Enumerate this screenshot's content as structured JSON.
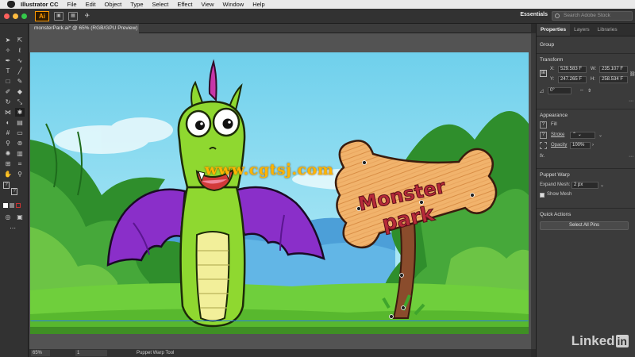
{
  "menubar": {
    "app": "Illustrator CC",
    "items": [
      "File",
      "Edit",
      "Object",
      "Type",
      "Select",
      "Effect",
      "View",
      "Window",
      "Help"
    ]
  },
  "appbar": {
    "logo": "Ai",
    "workspace": "Essentials",
    "stock_placeholder": "Search Adobe Stock"
  },
  "document": {
    "tab_title": "monsterPark.ai* @ 65% (RGB/GPU Preview)"
  },
  "status": {
    "zoom": "65%",
    "page": "1",
    "tool": "Puppet Warp Tool"
  },
  "panel": {
    "tabs": [
      "Properties",
      "Layers",
      "Libraries"
    ],
    "selection_type": "Group",
    "transform": {
      "title": "Transform",
      "x_label": "X:",
      "x": "529.583 F",
      "y_label": "Y:",
      "y": "247.265 F",
      "w_label": "W:",
      "w": "235.107 F",
      "h_label": "H:",
      "h": "258.534 F",
      "angle": "0°"
    },
    "appearance": {
      "title": "Appearance",
      "fill": "Fill",
      "stroke": "Stroke",
      "opacity_label": "Opacity",
      "opacity": "100%",
      "fx": "fx."
    },
    "puppet_warp": {
      "title": "Puppet Warp",
      "expand_label": "Expand Mesh:",
      "expand_value": "2 px",
      "show_mesh": "Show Mesh"
    },
    "quick_actions": {
      "title": "Quick Actions",
      "select_all_pins": "Select All Pins"
    }
  },
  "artwork": {
    "sign_line1": "Monster",
    "sign_line2": "park",
    "watermark": "www.cgtsj.com"
  },
  "brand": {
    "name": "Linked",
    "in": "in"
  },
  "colors": {
    "sky": "#7fd6ee",
    "grass": "#6fcf3c",
    "dragon_green": "#8fd830",
    "wing_purple": "#8a2fc9",
    "sign_wood": "#f1b36c",
    "sign_text": "#b72a3a"
  }
}
